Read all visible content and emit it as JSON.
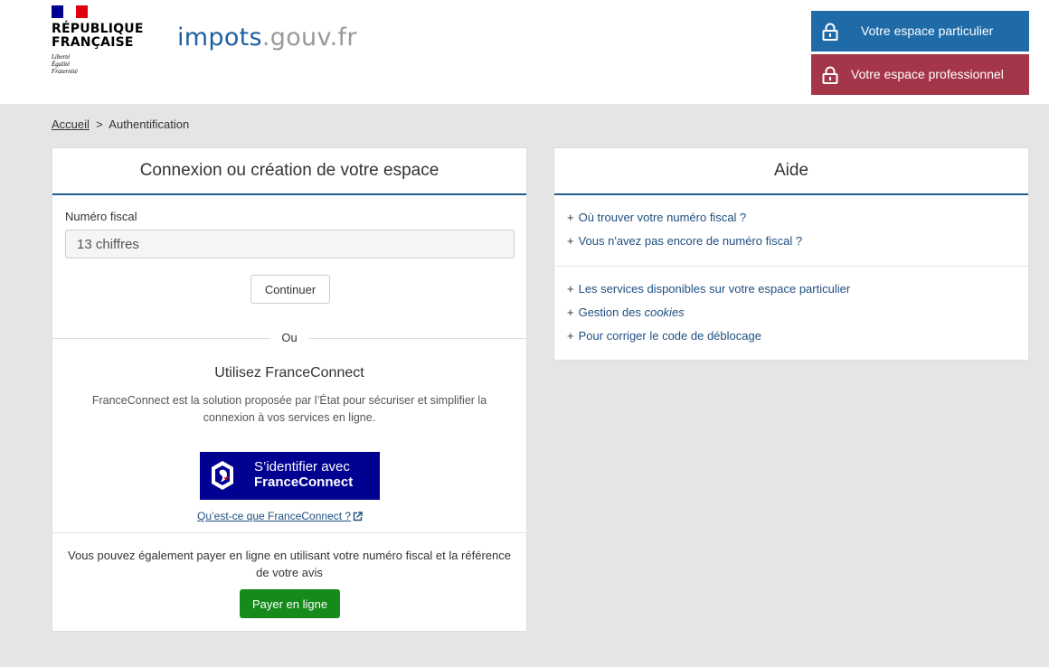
{
  "header": {
    "republique_line1": "RÉPUBLIQUE",
    "republique_line2": "FRANÇAISE",
    "motto": [
      "Liberté",
      "Égalité",
      "Fraternité"
    ],
    "site_name_main": "impots",
    "site_name_suffix": ".gouv.fr",
    "espace_particulier": "Votre espace particulier",
    "espace_professionnel": "Votre espace professionnel"
  },
  "breadcrumb": {
    "home": "Accueil",
    "separator": ">",
    "current": "Authentification"
  },
  "login": {
    "title": "Connexion ou création de votre espace",
    "field_label": "Numéro fiscal",
    "field_placeholder": "13 chiffres",
    "field_value": "",
    "continue_label": "Continuer",
    "or_label": "Ou",
    "fc_title": "Utilisez FranceConnect",
    "fc_description": "FranceConnect est la solution proposée par l’État pour sécuriser et simplifier la connexion à vos services en ligne.",
    "fc_button_line1": "S’identifier avec",
    "fc_button_line2": "FranceConnect",
    "fc_link": "Qu’est-ce que FranceConnect ?",
    "pay_text": "Vous pouvez également payer en ligne en utilisant votre numéro fiscal et la référence de votre avis",
    "pay_button": "Payer en ligne"
  },
  "help": {
    "title": "Aide",
    "group1": [
      "Où trouver votre numéro fiscal ?",
      "Vous n'avez pas encore de numéro fiscal ?"
    ],
    "group2": [
      "Les services disponibles sur votre espace particulier"
    ],
    "cookies_prefix": "Gestion des ",
    "cookies_word": "cookies",
    "group2_last": "Pour corriger le code de déblocage"
  },
  "colors": {
    "particulier_blue": "#1f6ba8",
    "professionnel_red": "#a5364a",
    "franceconnect_blue": "#000091",
    "pay_green": "#168a1b",
    "link_blue": "#1f4f80"
  },
  "icons": {
    "espace_buttons": "padlock-icon",
    "fc_link": "external-link-icon",
    "fc_button": "marianne-icon"
  }
}
